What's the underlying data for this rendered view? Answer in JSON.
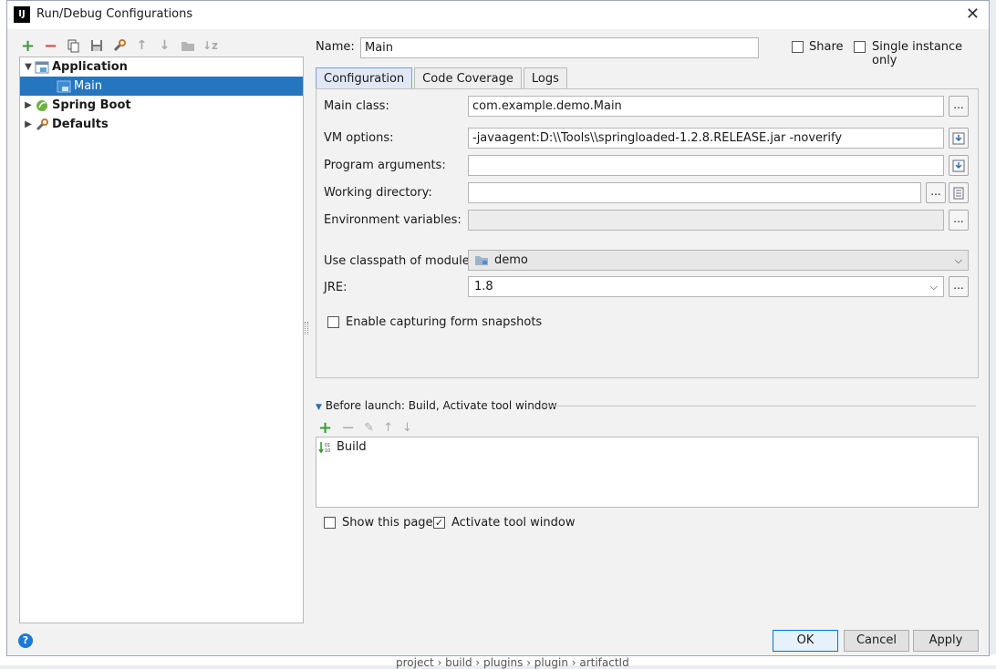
{
  "window": {
    "title": "Run/Debug Configurations"
  },
  "tree": {
    "items": [
      {
        "label": "Application"
      },
      {
        "label": "Main"
      },
      {
        "label": "Spring Boot"
      },
      {
        "label": "Defaults"
      }
    ]
  },
  "form": {
    "name_label": "Name:",
    "name_value": "Main",
    "share_label": "Share",
    "single_instance_label": "Single instance only",
    "tabs": [
      "Configuration",
      "Code Coverage",
      "Logs"
    ],
    "main_class_label": "Main class:",
    "main_class_value": "com.example.demo.Main",
    "vm_options_label": "VM options:",
    "vm_options_value": "-javaagent:D:\\\\Tools\\\\springloaded-1.2.8.RELEASE.jar -noverify",
    "program_args_label": "Program arguments:",
    "program_args_value": "",
    "working_dir_label": "Working directory:",
    "working_dir_value": "",
    "env_vars_label": "Environment variables:",
    "env_vars_value": "",
    "classpath_label": "Use classpath of module:",
    "classpath_value": "demo",
    "jre_label": "JRE:",
    "jre_value": "1.8",
    "snapshots_label": "Enable capturing form snapshots"
  },
  "before_launch": {
    "header": "Before launch: Build, Activate tool window",
    "items": [
      "Build"
    ],
    "show_page_label": "Show this page",
    "activate_label": "Activate tool window"
  },
  "buttons": {
    "ok": "OK",
    "cancel": "Cancel",
    "apply": "Apply",
    "help": "?"
  },
  "background": {
    "breadcrumb": "project  ›  build  ›  plugins  ›  plugin  ›  artifactId"
  },
  "colors": {
    "selection": "#2675bf",
    "add_green": "#3b9b3b",
    "remove_red": "#c94f4f",
    "primary_border": "#0078d7"
  }
}
